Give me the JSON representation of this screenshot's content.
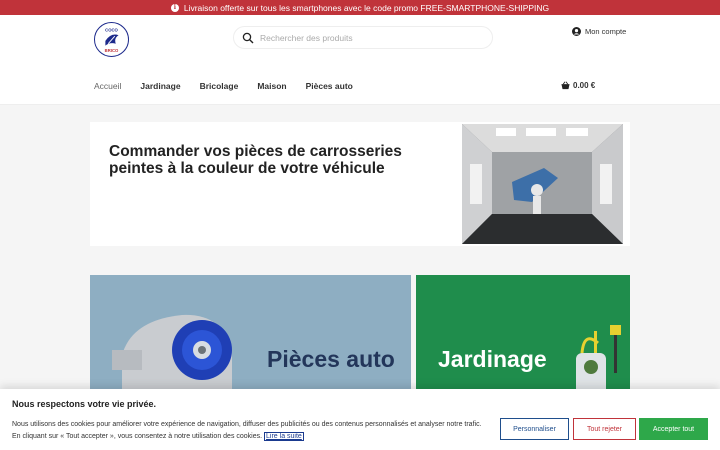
{
  "promo": {
    "text": "Livraison offerte sur tous les smartphones avec le code promo FREE-SMARTPHONE-SHIPPING"
  },
  "header": {
    "logo_top_text": "COCO",
    "logo_bottom_text": "BRICO",
    "search_placeholder": "Rechercher des produits",
    "account_label": "Mon compte",
    "cart_total": "0.00 €"
  },
  "nav": {
    "items": [
      {
        "label": "Accueil"
      },
      {
        "label": "Jardinage"
      },
      {
        "label": "Bricolage"
      },
      {
        "label": "Maison"
      },
      {
        "label": "Pièces auto"
      }
    ]
  },
  "hero": {
    "title": "Commander vos pièces de carrosseries peintes à la couleur de votre véhicule"
  },
  "tiles": {
    "auto_label": "Pièces auto",
    "garden_label": "Jardinage"
  },
  "cookie": {
    "title": "Nous respectons votre vie privée.",
    "text": "Nous utilisons des cookies pour améliorer votre expérience de navigation, diffuser des publicités ou des contenus personnalisés et analyser notre trafic. En cliquant sur « Tout accepter », vous consentez à notre utilisation des cookies.",
    "link": "Lire la suite",
    "customize": "Personnaliser",
    "reject": "Tout rejeter",
    "accept": "Accepter tout"
  },
  "colors": {
    "promo_bg": "#c0333a",
    "tile_auto_bg": "#8eaec2",
    "tile_garden_bg": "#1f8d4c",
    "accept_green": "#2ea84a"
  }
}
